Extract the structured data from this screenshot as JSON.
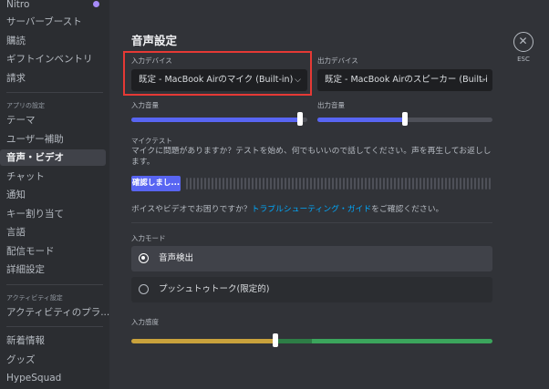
{
  "sidebar": {
    "items_top": [
      "Nitro",
      "サーバーブースト",
      "購読",
      "ギフトインベントリ",
      "請求"
    ],
    "app_settings_header": "アプリの設定",
    "app_items": [
      "テーマ",
      "ユーザー補助",
      "音声・ビデオ",
      "チャット",
      "通知",
      "キー割り当て",
      "言語",
      "配信モード",
      "詳細設定"
    ],
    "activity_header": "アクティビティ設定",
    "activity_items": [
      "アクティビティのプラ..."
    ],
    "bottom_items": [
      "新着情報",
      "グッズ",
      "HypeSquad"
    ]
  },
  "main": {
    "title": "音声設定",
    "input_device_label": "入力デバイス",
    "input_device_value": "既定 - MacBook Airのマイク (Built-in)",
    "output_device_label": "出力デバイス",
    "output_device_value": "既定 - MacBook Airのスピーカー (Built-i",
    "input_volume_label": "入力音量",
    "output_volume_label": "出力音量",
    "input_volume": 0.96,
    "output_volume": 0.5,
    "mic_test_label": "マイクテスト",
    "mic_test_desc": "マイクに問題がありますか？テストを始め、何でもいいので話してください。声を再生してお返しします。",
    "test_button": "確認しまし...",
    "help_prefix": "ボイスやビデオでお困りですか？",
    "help_link": "トラブルシューティング・ガイド",
    "help_suffix": "をご確認ください。",
    "input_mode_label": "入力モード",
    "mode_voice": "音声検出",
    "mode_ptt": "プッシュトゥトーク(限定的)",
    "sensitivity_label": "入力感度",
    "sensitivity": 0.4
  },
  "close": {
    "label": "ESC"
  },
  "colors": {
    "accent": "#5865f2",
    "link": "#00a8fc",
    "highlight": "#e53935",
    "sens_low": "#c9a23c",
    "sens_high": "#3ba55c"
  }
}
